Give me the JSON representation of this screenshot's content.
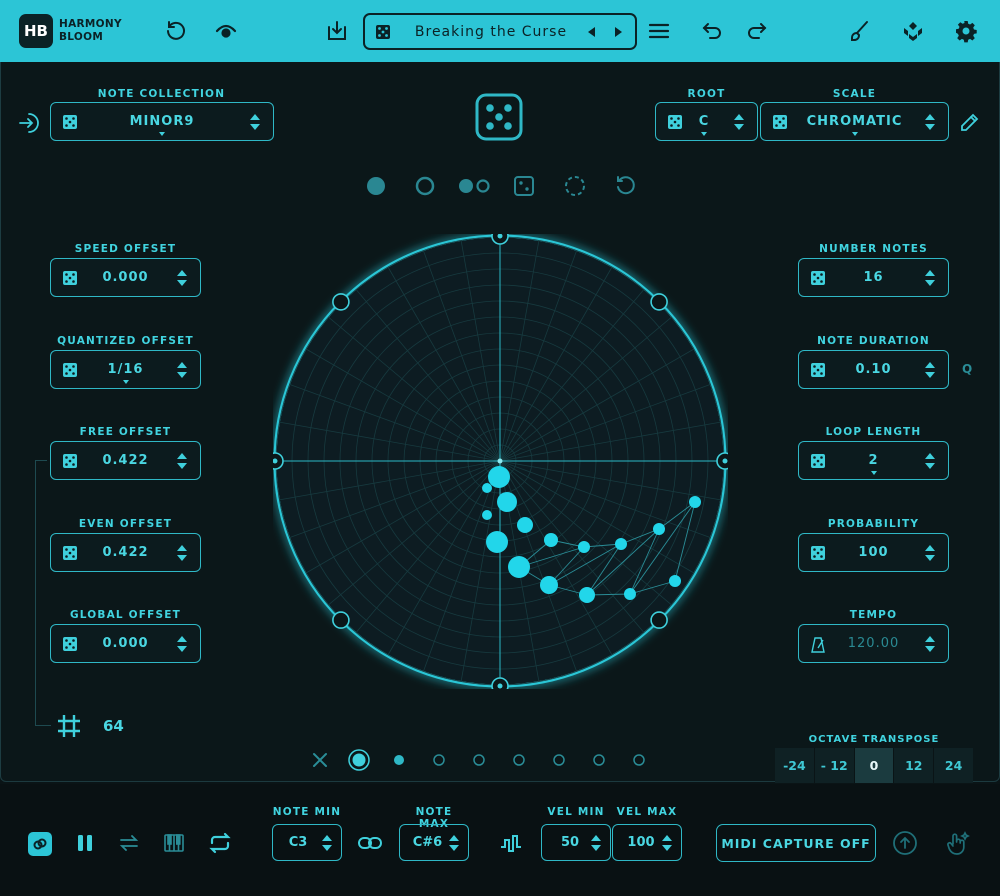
{
  "header": {
    "logo_initials": "HB",
    "logo_line1": "HARMONY",
    "logo_line2": "BLOOM",
    "preset_name": "Breaking the Curse"
  },
  "note_collection": {
    "label": "NOTE COLLECTION",
    "value": "MINOR9"
  },
  "root": {
    "label": "ROOT",
    "value": "C"
  },
  "scale": {
    "label": "SCALE",
    "value": "CHROMATIC"
  },
  "left_params": [
    {
      "label": "SPEED OFFSET",
      "value": "0.000"
    },
    {
      "label": "QUANTIZED OFFSET",
      "value": "1/16"
    },
    {
      "label": "FREE OFFSET",
      "value": "0.422"
    },
    {
      "label": "EVEN OFFSET",
      "value": "0.422"
    },
    {
      "label": "GLOBAL OFFSET",
      "value": "0.000"
    }
  ],
  "right_params": [
    {
      "label": "NUMBER NOTES",
      "value": "16"
    },
    {
      "label": "NOTE DURATION",
      "value": "0.10"
    },
    {
      "label": "LOOP LENGTH",
      "value": "2"
    },
    {
      "label": "PROBABILITY",
      "value": "100"
    },
    {
      "label": "TEMPO",
      "value": "120.00"
    }
  ],
  "note_duration_suffix": "Q",
  "grid_value": "64",
  "octave": {
    "label": "OCTAVE TRANSPOSE",
    "options": [
      "-24",
      "- 12",
      "0",
      "12",
      "24"
    ],
    "selected": "0"
  },
  "footer": {
    "note_min_label": "NOTE MIN",
    "note_min": "C3",
    "note_max_label": "NOTE MAX",
    "note_max": "C#6",
    "vel_min_label": "VEL MIN",
    "vel_min": "50",
    "vel_max_label": "VEL MAX",
    "vel_max": "100",
    "midi_capture": "MIDI CAPTURE OFF"
  },
  "colors": {
    "accent": "#2cc5d6",
    "background": "#0a1416",
    "dot": "#22d6ea"
  }
}
